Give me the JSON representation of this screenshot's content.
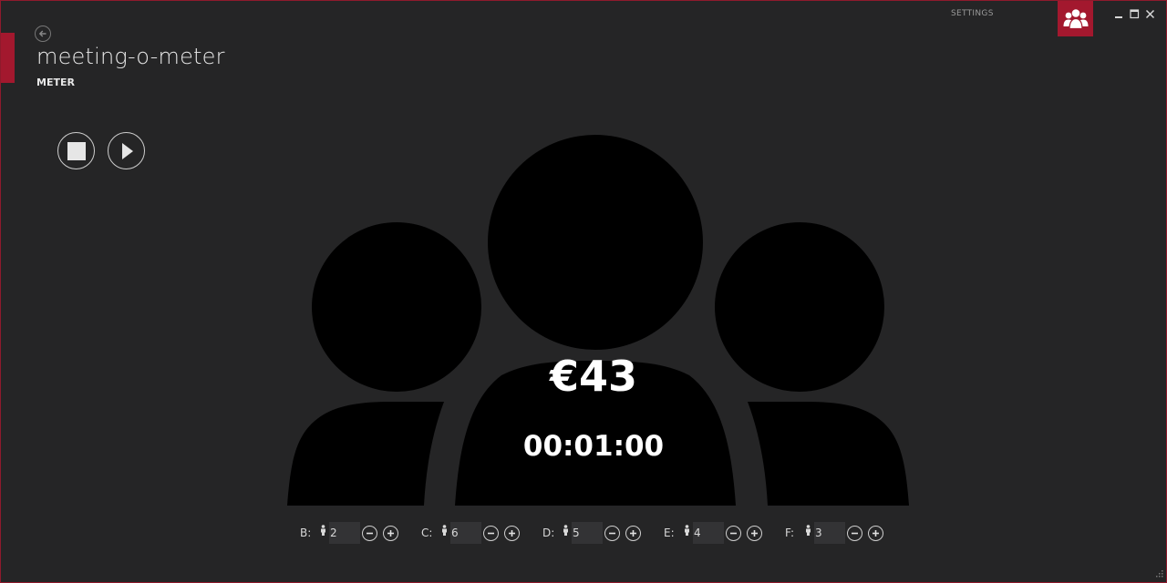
{
  "app": {
    "title": "meeting-o-meter",
    "section": "METER",
    "settings_label": "SETTINGS",
    "accent_color": "#a3182e"
  },
  "window_controls": [
    "minimize-icon",
    "maximize-icon",
    "close-icon"
  ],
  "meter": {
    "cost": "€43",
    "elapsed": "00:01:00"
  },
  "media_controls": {
    "stop_icon": "stop-icon",
    "play_icon": "play-icon"
  },
  "groups": [
    {
      "label": "B:",
      "count": "2"
    },
    {
      "label": "C:",
      "count": "6"
    },
    {
      "label": "D:",
      "count": "5"
    },
    {
      "label": "E:",
      "count": "4"
    },
    {
      "label": "F:",
      "count": "3"
    }
  ]
}
